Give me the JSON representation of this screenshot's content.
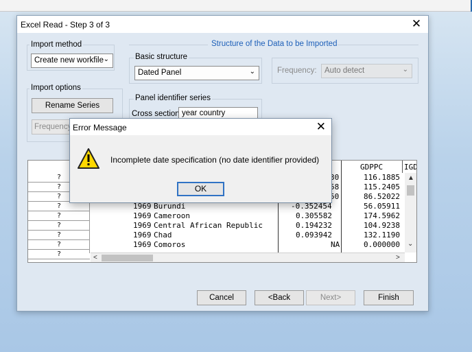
{
  "window": {
    "title": "Excel Read - Step 3 of 3",
    "close_glyph": "✕"
  },
  "import_method": {
    "label": "Import method",
    "value": "Create new workfile"
  },
  "import_options": {
    "label": "Import options",
    "rename_label": "Rename Series",
    "frequency_label": "Frequency"
  },
  "structure": {
    "title": "Structure of the Data to be Imported",
    "basic_label": "Basic structure",
    "basic_value": "Dated Panel",
    "frequency_label": "Frequency:",
    "frequency_value": "Auto detect",
    "panel_label": "Panel identifier series",
    "cross_section_label": "Cross section",
    "cross_section_value": "year country"
  },
  "grid": {
    "row_headers": [
      "?",
      "?",
      "?",
      "?",
      "?",
      "?",
      "?",
      "?",
      "?",
      "?"
    ],
    "col_headers": [
      "GDPPC",
      "IGD"
    ],
    "rows": [
      {
        "year": "",
        "country": "",
        "v1": "30",
        "v2": "116.1885"
      },
      {
        "year": "",
        "country": "",
        "v1": "58",
        "v2": "115.2405"
      },
      {
        "year": "",
        "country": "",
        "v1": "50",
        "v2": "86.52022"
      },
      {
        "year": "1969",
        "country": "Burundi",
        "v1": "-0.352454",
        "v2": "56.05911"
      },
      {
        "year": "1969",
        "country": "Cameroon",
        "v1": "0.305582",
        "v2": "174.5962"
      },
      {
        "year": "1969",
        "country": "Central African Republic",
        "v1": "0.194232",
        "v2": "104.9238"
      },
      {
        "year": "1969",
        "country": "Chad",
        "v1": "0.093942",
        "v2": "132.1190"
      },
      {
        "year": "1969",
        "country": "Comoros",
        "v1": "NA",
        "v2": "0.000000"
      }
    ]
  },
  "buttons": {
    "cancel": "Cancel",
    "back": "<Back",
    "next": "Next>",
    "finish": "Finish"
  },
  "error_dialog": {
    "title": "Error Message",
    "close_glyph": "✕",
    "message": "Incomplete date specification (no date identifier provided)",
    "ok_label": "OK"
  },
  "icons": {
    "dropdown": "chevron-down-icon",
    "warning": "warning-icon"
  },
  "colors": {
    "accent": "#1d5fb8",
    "focus_border": "#2f72c4",
    "warning_fill": "#ffd800"
  }
}
